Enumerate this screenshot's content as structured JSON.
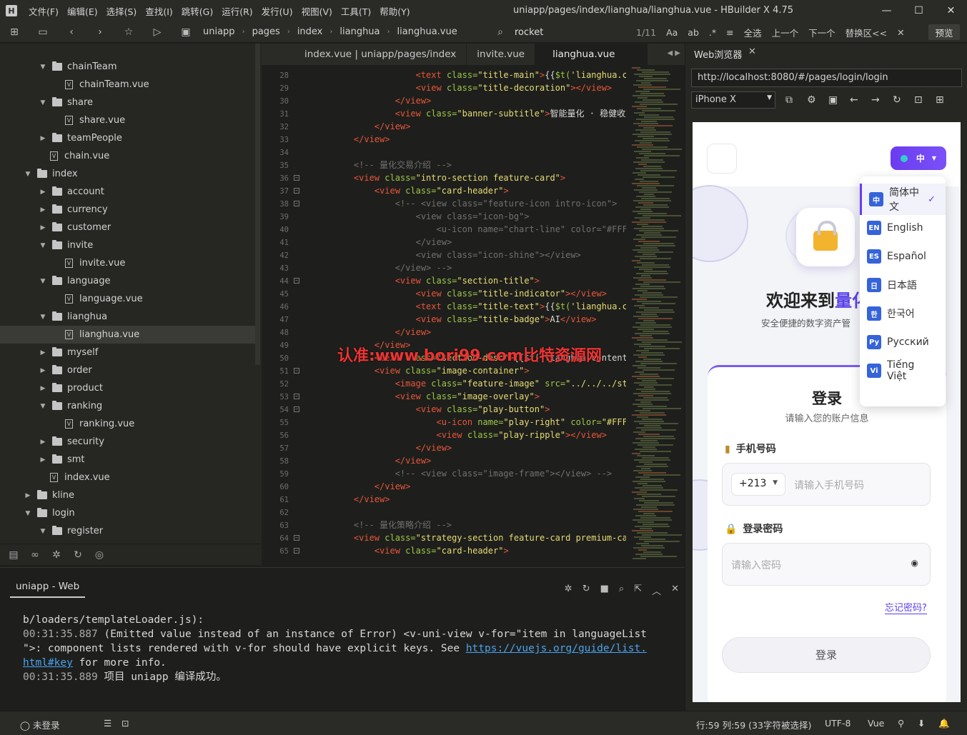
{
  "window": {
    "title": "uniapp/pages/index/lianghua/lianghua.vue - HBuilder X 4.75"
  },
  "menu": [
    "文件(F)",
    "编辑(E)",
    "选择(S)",
    "查找(I)",
    "跳转(G)",
    "运行(R)",
    "发行(U)",
    "视图(V)",
    "工具(T)",
    "帮助(Y)"
  ],
  "toolbar": {
    "breadcrumb": [
      "uniapp",
      "pages",
      "index",
      "lianghua",
      "lianghua.vue"
    ],
    "search": "rocket",
    "match": "1/11",
    "select_all": "全选",
    "prev": "上一个",
    "next": "下一个",
    "replace": "替换区<<",
    "preview": "预览"
  },
  "tree": [
    {
      "label": "chainTeam",
      "type": "folder",
      "open": true,
      "depth": 3
    },
    {
      "label": "chainTeam.vue",
      "type": "file",
      "depth": 4
    },
    {
      "label": "share",
      "type": "folder",
      "open": true,
      "depth": 3
    },
    {
      "label": "share.vue",
      "type": "file",
      "depth": 4
    },
    {
      "label": "teamPeople",
      "type": "folder",
      "open": false,
      "depth": 3
    },
    {
      "label": "chain.vue",
      "type": "file",
      "depth": 3
    },
    {
      "label": "index",
      "type": "folder",
      "open": true,
      "depth": 2
    },
    {
      "label": "account",
      "type": "folder",
      "open": false,
      "depth": 3
    },
    {
      "label": "currency",
      "type": "folder",
      "open": false,
      "depth": 3
    },
    {
      "label": "customer",
      "type": "folder",
      "open": false,
      "depth": 3
    },
    {
      "label": "invite",
      "type": "folder",
      "open": true,
      "depth": 3
    },
    {
      "label": "invite.vue",
      "type": "file",
      "depth": 4
    },
    {
      "label": "language",
      "type": "folder",
      "open": true,
      "depth": 3
    },
    {
      "label": "language.vue",
      "type": "file",
      "depth": 4
    },
    {
      "label": "lianghua",
      "type": "folder",
      "open": true,
      "depth": 3
    },
    {
      "label": "lianghua.vue",
      "type": "file",
      "depth": 4,
      "selected": true
    },
    {
      "label": "myself",
      "type": "folder",
      "open": false,
      "depth": 3
    },
    {
      "label": "order",
      "type": "folder",
      "open": false,
      "depth": 3
    },
    {
      "label": "product",
      "type": "folder",
      "open": false,
      "depth": 3
    },
    {
      "label": "ranking",
      "type": "folder",
      "open": true,
      "depth": 3
    },
    {
      "label": "ranking.vue",
      "type": "file",
      "depth": 4
    },
    {
      "label": "security",
      "type": "folder",
      "open": false,
      "depth": 3
    },
    {
      "label": "smt",
      "type": "folder",
      "open": false,
      "depth": 3
    },
    {
      "label": "index.vue",
      "type": "file",
      "depth": 3
    },
    {
      "label": "kline",
      "type": "folder",
      "open": false,
      "depth": 2
    },
    {
      "label": "login",
      "type": "folder",
      "open": true,
      "depth": 2
    },
    {
      "label": "register",
      "type": "folder",
      "open": true,
      "depth": 3
    }
  ],
  "tabs": [
    "index.vue | uniapp/pages/index",
    "invite.vue",
    "lianghua.vue"
  ],
  "code": [
    {
      "n": "28",
      "segs": [
        [
          "t-tag",
          "                <text "
        ],
        [
          "t-attr",
          "class="
        ],
        [
          "t-str",
          "\"title-main\""
        ],
        [
          "t-tag",
          ">"
        ],
        [
          "t-txt",
          "{{"
        ],
        [
          "t-attr",
          "$t("
        ],
        [
          "t-str",
          "'lianghua.conten"
        ]
      ]
    },
    {
      "n": "29",
      "segs": [
        [
          "t-tag",
          "                <view "
        ],
        [
          "t-attr",
          "class="
        ],
        [
          "t-str",
          "\"title-decoration\""
        ],
        [
          "t-tag",
          "></view>"
        ]
      ]
    },
    {
      "n": "30",
      "segs": [
        [
          "t-tag",
          "            </view>"
        ]
      ]
    },
    {
      "n": "31",
      "segs": [
        [
          "t-tag",
          "            <view "
        ],
        [
          "t-attr",
          "class="
        ],
        [
          "t-str",
          "\"banner-subtitle\""
        ],
        [
          "t-tag",
          ">"
        ],
        [
          "t-txt",
          "智能量化 · 稳健收益 ·"
        ]
      ]
    },
    {
      "n": "32",
      "segs": [
        [
          "t-tag",
          "        </view>"
        ]
      ]
    },
    {
      "n": "33",
      "segs": [
        [
          "t-tag",
          "    </view>"
        ]
      ]
    },
    {
      "n": "34",
      "segs": []
    },
    {
      "n": "35",
      "segs": [
        [
          "t-com",
          "    <!-- 量化交易介绍 -->"
        ]
      ]
    },
    {
      "n": "36",
      "fold": true,
      "segs": [
        [
          "t-tag",
          "    <view "
        ],
        [
          "t-attr",
          "class="
        ],
        [
          "t-str",
          "\"intro-section feature-card\""
        ],
        [
          "t-tag",
          ">"
        ]
      ]
    },
    {
      "n": "37",
      "fold": true,
      "segs": [
        [
          "t-tag",
          "        <view "
        ],
        [
          "t-attr",
          "class="
        ],
        [
          "t-str",
          "\"card-header\""
        ],
        [
          "t-tag",
          ">"
        ]
      ]
    },
    {
      "n": "38",
      "fold": true,
      "segs": [
        [
          "t-com",
          "            <!-- <view class=\"feature-icon intro-icon\">"
        ]
      ]
    },
    {
      "n": "39",
      "segs": [
        [
          "t-com",
          "                <view class=\"icon-bg\">"
        ]
      ]
    },
    {
      "n": "40",
      "segs": [
        [
          "t-com",
          "                    <u-icon name=\"chart-line\" color=\"#FFFFFF\""
        ]
      ]
    },
    {
      "n": "41",
      "segs": [
        [
          "t-com",
          "                </view>"
        ]
      ]
    },
    {
      "n": "42",
      "segs": [
        [
          "t-com",
          "                <view class=\"icon-shine\"></view>"
        ]
      ]
    },
    {
      "n": "43",
      "segs": [
        [
          "t-com",
          "            </view> -->"
        ]
      ]
    },
    {
      "n": "44",
      "fold": true,
      "segs": [
        [
          "t-tag",
          "            <view "
        ],
        [
          "t-attr",
          "class="
        ],
        [
          "t-str",
          "\"section-title\""
        ],
        [
          "t-tag",
          ">"
        ]
      ]
    },
    {
      "n": "45",
      "segs": [
        [
          "t-tag",
          "                <view "
        ],
        [
          "t-attr",
          "class="
        ],
        [
          "t-str",
          "\"title-indicator\""
        ],
        [
          "t-tag",
          "></view>"
        ]
      ]
    },
    {
      "n": "46",
      "segs": [
        [
          "t-tag",
          "                <text "
        ],
        [
          "t-attr",
          "class="
        ],
        [
          "t-str",
          "\"title-text\""
        ],
        [
          "t-tag",
          ">"
        ],
        [
          "t-txt",
          "{{"
        ],
        [
          "t-attr",
          "$t("
        ],
        [
          "t-str",
          "'lianghua.conten"
        ]
      ]
    },
    {
      "n": "47",
      "segs": [
        [
          "t-tag",
          "                <view "
        ],
        [
          "t-attr",
          "class="
        ],
        [
          "t-str",
          "\"title-badge\""
        ],
        [
          "t-tag",
          ">"
        ],
        [
          "t-txt",
          "AI"
        ],
        [
          "t-tag",
          "</view>"
        ]
      ]
    },
    {
      "n": "48",
      "segs": [
        [
          "t-tag",
          "            </view>"
        ]
      ]
    },
    {
      "n": "49",
      "segs": [
        [
          "t-tag",
          "        </view>"
        ]
      ]
    },
    {
      "n": "50",
      "segs": [
        [
          "t-tag",
          "        <text "
        ],
        [
          "t-attr",
          "class="
        ],
        [
          "t-str",
          "\"section-desc\""
        ],
        [
          "t-tag",
          ">"
        ],
        [
          "t-txt",
          "{{$t('lianghua.content"
        ]
      ]
    },
    {
      "n": "51",
      "fold": true,
      "segs": [
        [
          "t-tag",
          "        <view "
        ],
        [
          "t-attr",
          "class="
        ],
        [
          "t-str",
          "\"image-container\""
        ],
        [
          "t-tag",
          ">"
        ]
      ]
    },
    {
      "n": "52",
      "segs": [
        [
          "t-tag",
          "            <image "
        ],
        [
          "t-attr",
          "class="
        ],
        [
          "t-str",
          "\"feature-image\" "
        ],
        [
          "t-attr",
          "src="
        ],
        [
          "t-str",
          "\"../../../static/"
        ]
      ]
    },
    {
      "n": "53",
      "fold": true,
      "segs": [
        [
          "t-tag",
          "            <view "
        ],
        [
          "t-attr",
          "class="
        ],
        [
          "t-str",
          "\"image-overlay\""
        ],
        [
          "t-tag",
          ">"
        ]
      ]
    },
    {
      "n": "54",
      "fold": true,
      "segs": [
        [
          "t-tag",
          "                <view "
        ],
        [
          "t-attr",
          "class="
        ],
        [
          "t-str",
          "\"play-button\""
        ],
        [
          "t-tag",
          ">"
        ]
      ]
    },
    {
      "n": "55",
      "segs": [
        [
          "t-tag",
          "                    <u-icon "
        ],
        [
          "t-attr",
          "name="
        ],
        [
          "t-str",
          "\"play-right\" "
        ],
        [
          "t-attr",
          "color="
        ],
        [
          "t-str",
          "\"#FFFFFF\""
        ]
      ]
    },
    {
      "n": "56",
      "segs": [
        [
          "t-tag",
          "                    <view "
        ],
        [
          "t-attr",
          "class="
        ],
        [
          "t-str",
          "\"play-ripple\""
        ],
        [
          "t-tag",
          "></view>"
        ]
      ]
    },
    {
      "n": "57",
      "segs": [
        [
          "t-tag",
          "                </view>"
        ]
      ]
    },
    {
      "n": "58",
      "segs": [
        [
          "t-tag",
          "            </view>"
        ]
      ]
    },
    {
      "n": "59",
      "segs": [
        [
          "t-com",
          "            <!-- <view class=\"image-frame\"></view> -->"
        ]
      ]
    },
    {
      "n": "60",
      "segs": [
        [
          "t-tag",
          "        </view>"
        ]
      ]
    },
    {
      "n": "61",
      "segs": [
        [
          "t-tag",
          "    </view>"
        ]
      ]
    },
    {
      "n": "62",
      "segs": []
    },
    {
      "n": "63",
      "segs": [
        [
          "t-com",
          "    <!-- 量化策略介绍 -->"
        ]
      ]
    },
    {
      "n": "64",
      "fold": true,
      "segs": [
        [
          "t-tag",
          "    <view "
        ],
        [
          "t-attr",
          "class="
        ],
        [
          "t-str",
          "\"strategy-section feature-card premium-card\""
        ],
        [
          "t-tag",
          ">"
        ]
      ]
    },
    {
      "n": "65",
      "fold": true,
      "segs": [
        [
          "t-tag",
          "        <view "
        ],
        [
          "t-attr",
          "class="
        ],
        [
          "t-str",
          "\"card-header\""
        ],
        [
          "t-tag",
          ">"
        ]
      ]
    }
  ],
  "watermark": "认准:www.bori99.com比特资源网",
  "console": {
    "tab": "uniapp - Web",
    "l1": "b/loaders/templateLoader.js):",
    "t2": "00:31:35.887",
    "m2": " (Emitted value instead of an instance of Error) <v-uni-view v-for=\"item in languageList\n\">: component lists rendered with v-for should have explicit keys. See ",
    "link": "https://vuejs.org/guide/list.\nhtml#key",
    "m2b": " for more info.",
    "t3": "00:31:35.889",
    "m3": " 项目 uniapp 编译成功。"
  },
  "browser": {
    "tab": "Web浏览器",
    "url": "http://localhost:8080/#/pages/login/login",
    "device": "iPhone X"
  },
  "phone": {
    "lang_button": "中",
    "welcome_prefix": "欢迎来到",
    "welcome_highlight": "量化",
    "subtitle": "安全便捷的数字资产管",
    "login_title": "登录",
    "login_sub": "请输入您的账户信息",
    "phone_label": "手机号码",
    "country_code": "+213",
    "phone_placeholder": "请输入手机号码",
    "pw_label": "登录密码",
    "pw_placeholder": "请输入密码",
    "forgot": "忘记密码?",
    "login_btn": "登录"
  },
  "languages": [
    {
      "badge": "中",
      "label": "简体中文",
      "selected": true
    },
    {
      "badge": "EN",
      "label": "English"
    },
    {
      "badge": "ES",
      "label": "Español"
    },
    {
      "badge": "日",
      "label": "日本語"
    },
    {
      "badge": "한",
      "label": "한국어"
    },
    {
      "badge": "Py",
      "label": "Русский"
    },
    {
      "badge": "Vi",
      "label": "Tiếng Việt"
    }
  ],
  "status": {
    "user": "未登录",
    "position": "行:59  列:59 (33字符被选择)",
    "encoding": "UTF-8",
    "lang": "Vue"
  }
}
